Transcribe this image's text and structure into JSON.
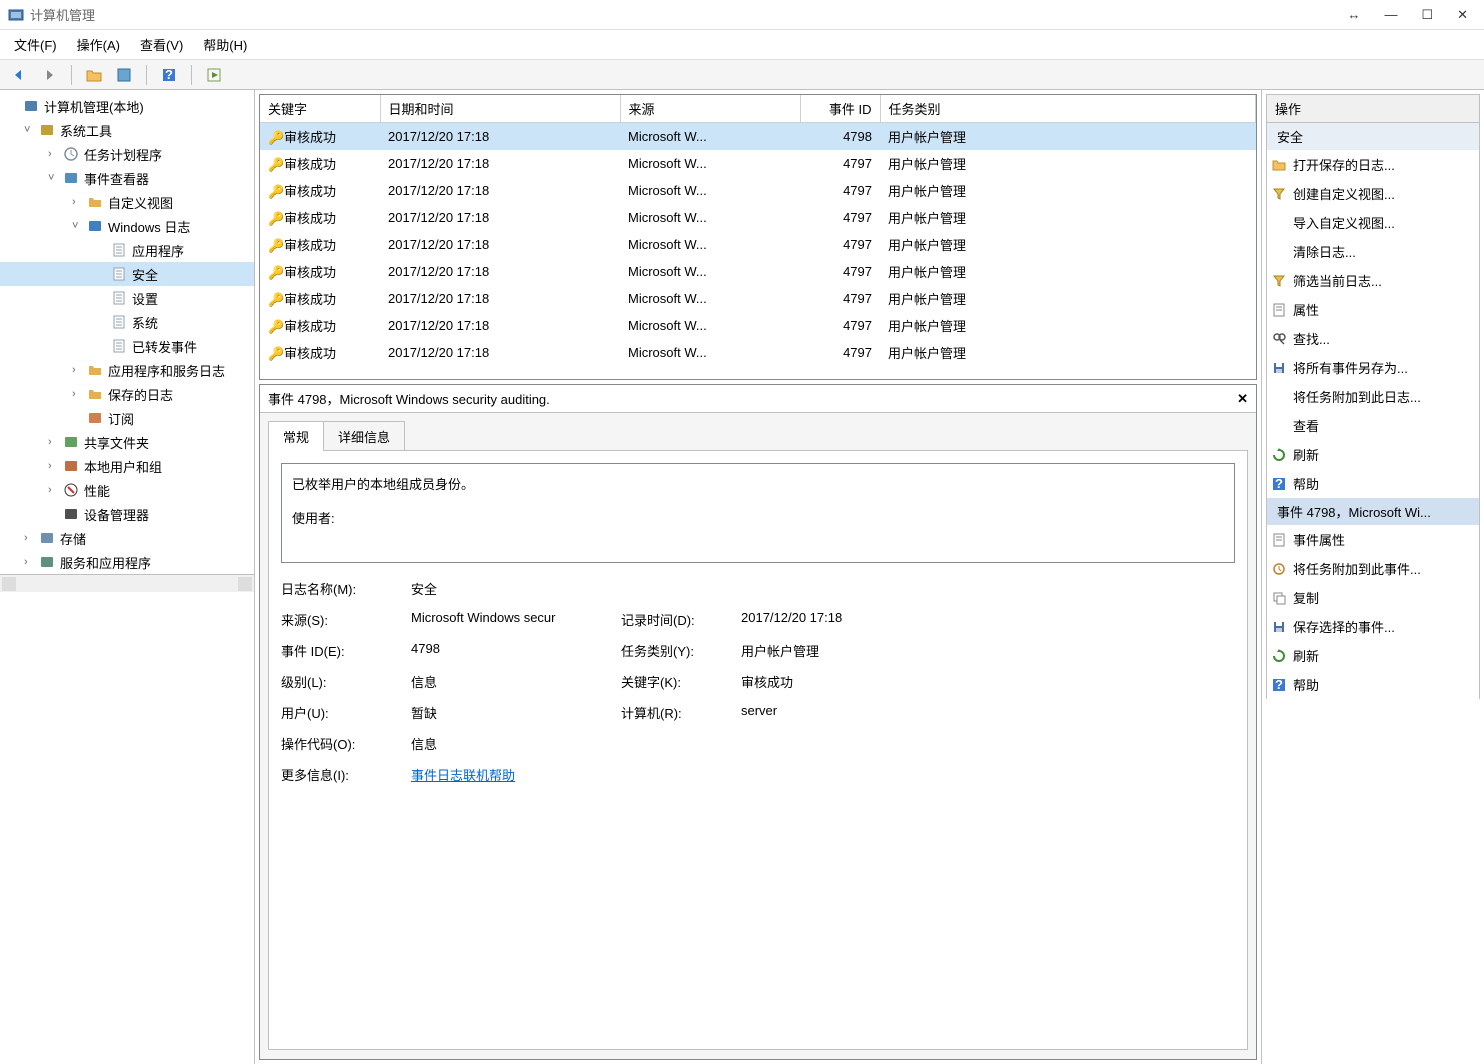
{
  "window": {
    "title": "计算机管理"
  },
  "menubar": {
    "file": "文件(F)",
    "action": "操作(A)",
    "view": "查看(V)",
    "help": "帮助(H)"
  },
  "tree": [
    {
      "indent": 0,
      "toggle": "",
      "icon": "mgmt",
      "label": "计算机管理(本地)"
    },
    {
      "indent": 1,
      "toggle": "v",
      "icon": "tools",
      "label": "系统工具"
    },
    {
      "indent": 2,
      "toggle": ">",
      "icon": "clock",
      "label": "任务计划程序"
    },
    {
      "indent": 2,
      "toggle": "v",
      "icon": "event",
      "label": "事件查看器"
    },
    {
      "indent": 3,
      "toggle": ">",
      "icon": "folder",
      "label": "自定义视图"
    },
    {
      "indent": 3,
      "toggle": "v",
      "icon": "winlog",
      "label": "Windows 日志"
    },
    {
      "indent": 4,
      "toggle": "",
      "icon": "log",
      "label": "应用程序"
    },
    {
      "indent": 4,
      "toggle": "",
      "icon": "log",
      "label": "安全",
      "selected": true
    },
    {
      "indent": 4,
      "toggle": "",
      "icon": "log",
      "label": "设置"
    },
    {
      "indent": 4,
      "toggle": "",
      "icon": "log",
      "label": "系统"
    },
    {
      "indent": 4,
      "toggle": "",
      "icon": "log",
      "label": "已转发事件"
    },
    {
      "indent": 3,
      "toggle": ">",
      "icon": "folder",
      "label": "应用程序和服务日志"
    },
    {
      "indent": 3,
      "toggle": ">",
      "icon": "folder",
      "label": "保存的日志"
    },
    {
      "indent": 3,
      "toggle": "",
      "icon": "sub",
      "label": "订阅"
    },
    {
      "indent": 2,
      "toggle": ">",
      "icon": "share",
      "label": "共享文件夹"
    },
    {
      "indent": 2,
      "toggle": ">",
      "icon": "users",
      "label": "本地用户和组"
    },
    {
      "indent": 2,
      "toggle": ">",
      "icon": "perf",
      "label": "性能"
    },
    {
      "indent": 2,
      "toggle": "",
      "icon": "device",
      "label": "设备管理器"
    },
    {
      "indent": 1,
      "toggle": ">",
      "icon": "storage",
      "label": "存储"
    },
    {
      "indent": 1,
      "toggle": ">",
      "icon": "service",
      "label": "服务和应用程序"
    }
  ],
  "grid": {
    "headers": {
      "keyword": "关键字",
      "datetime": "日期和时间",
      "source": "来源",
      "eventid": "事件 ID",
      "category": "任务类别"
    },
    "rows": [
      {
        "keyword": "审核成功",
        "datetime": "2017/12/20 17:18",
        "source": "Microsoft W...",
        "eventid": "4798",
        "category": "用户帐户管理",
        "selected": true
      },
      {
        "keyword": "审核成功",
        "datetime": "2017/12/20 17:18",
        "source": "Microsoft W...",
        "eventid": "4797",
        "category": "用户帐户管理"
      },
      {
        "keyword": "审核成功",
        "datetime": "2017/12/20 17:18",
        "source": "Microsoft W...",
        "eventid": "4797",
        "category": "用户帐户管理"
      },
      {
        "keyword": "审核成功",
        "datetime": "2017/12/20 17:18",
        "source": "Microsoft W...",
        "eventid": "4797",
        "category": "用户帐户管理"
      },
      {
        "keyword": "审核成功",
        "datetime": "2017/12/20 17:18",
        "source": "Microsoft W...",
        "eventid": "4797",
        "category": "用户帐户管理"
      },
      {
        "keyword": "审核成功",
        "datetime": "2017/12/20 17:18",
        "source": "Microsoft W...",
        "eventid": "4797",
        "category": "用户帐户管理"
      },
      {
        "keyword": "审核成功",
        "datetime": "2017/12/20 17:18",
        "source": "Microsoft W...",
        "eventid": "4797",
        "category": "用户帐户管理"
      },
      {
        "keyword": "审核成功",
        "datetime": "2017/12/20 17:18",
        "source": "Microsoft W...",
        "eventid": "4797",
        "category": "用户帐户管理"
      },
      {
        "keyword": "审核成功",
        "datetime": "2017/12/20 17:18",
        "source": "Microsoft W...",
        "eventid": "4797",
        "category": "用户帐户管理"
      }
    ]
  },
  "detail": {
    "title": "事件 4798，Microsoft Windows security auditing.",
    "tabs": {
      "general": "常规",
      "details": "详细信息"
    },
    "description": {
      "line1": "已枚举用户的本地组成员身份。",
      "line2": "使用者:"
    },
    "labels": {
      "logname": "日志名称(M):",
      "source": "来源(S):",
      "eventid": "事件 ID(E):",
      "level": "级别(L):",
      "user": "用户(U):",
      "opcode": "操作代码(O):",
      "more": "更多信息(I):",
      "logged": "记录时间(D):",
      "category": "任务类别(Y):",
      "keywords": "关键字(K):",
      "computer": "计算机(R):"
    },
    "values": {
      "logname": "安全",
      "source": "Microsoft Windows secur",
      "eventid": "4798",
      "level": "信息",
      "user": "暂缺",
      "opcode": "信息",
      "more": "事件日志联机帮助",
      "logged": "2017/12/20 17:18",
      "category": "用户帐户管理",
      "keywords": "审核成功",
      "computer": "server"
    }
  },
  "actions": {
    "header": "操作",
    "section1": "安全",
    "section2": "事件 4798，Microsoft Wi...",
    "items1": [
      {
        "icon": "folder-open",
        "label": "打开保存的日志..."
      },
      {
        "icon": "filter",
        "label": "创建自定义视图..."
      },
      {
        "icon": "",
        "label": "导入自定义视图..."
      },
      {
        "icon": "",
        "label": "清除日志..."
      },
      {
        "icon": "filter",
        "label": "筛选当前日志..."
      },
      {
        "icon": "props",
        "label": "属性"
      },
      {
        "icon": "find",
        "label": "查找..."
      },
      {
        "icon": "save",
        "label": "将所有事件另存为..."
      },
      {
        "icon": "",
        "label": "将任务附加到此日志..."
      },
      {
        "icon": "",
        "label": "查看"
      },
      {
        "icon": "refresh",
        "label": "刷新"
      },
      {
        "icon": "help",
        "label": "帮助"
      }
    ],
    "items2": [
      {
        "icon": "props",
        "label": "事件属性"
      },
      {
        "icon": "attach",
        "label": "将任务附加到此事件..."
      },
      {
        "icon": "copy",
        "label": "复制"
      },
      {
        "icon": "save",
        "label": "保存选择的事件..."
      },
      {
        "icon": "refresh",
        "label": "刷新"
      },
      {
        "icon": "help",
        "label": "帮助"
      }
    ]
  }
}
